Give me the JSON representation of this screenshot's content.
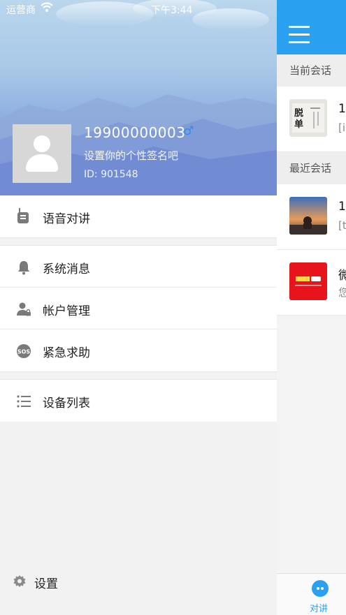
{
  "status_bar": {
    "carrier": "运营商",
    "time": "下午3:44"
  },
  "profile": {
    "phone": "19900000003",
    "gender_symbol": "♂",
    "signature": "设置你的个性签名吧",
    "id_text": "ID: 901548"
  },
  "menu": {
    "voice_intercom": "语音对讲",
    "system_messages": "系统消息",
    "account_management": "帐户管理",
    "emergency_help": "紧急求助",
    "device_list": "设备列表"
  },
  "settings_label": "设置",
  "main": {
    "current_section": "当前会话",
    "recent_section": "最近会话",
    "conversations": [
      {
        "title_partial": "1",
        "subtitle_partial": "[i"
      },
      {
        "title_partial": "1",
        "subtitle_partial": "[t"
      },
      {
        "title_partial": "微",
        "subtitle_partial": "您"
      }
    ],
    "tab_label": "对讲"
  },
  "colors": {
    "accent": "#29a1f0",
    "gender_icon": "#2b8ff0"
  },
  "icons": [
    "walkie-talkie-icon",
    "bell-icon",
    "user-lock-icon",
    "sos-icon",
    "list-icon",
    "gear-icon",
    "hamburger-icon",
    "chat-icon"
  ]
}
